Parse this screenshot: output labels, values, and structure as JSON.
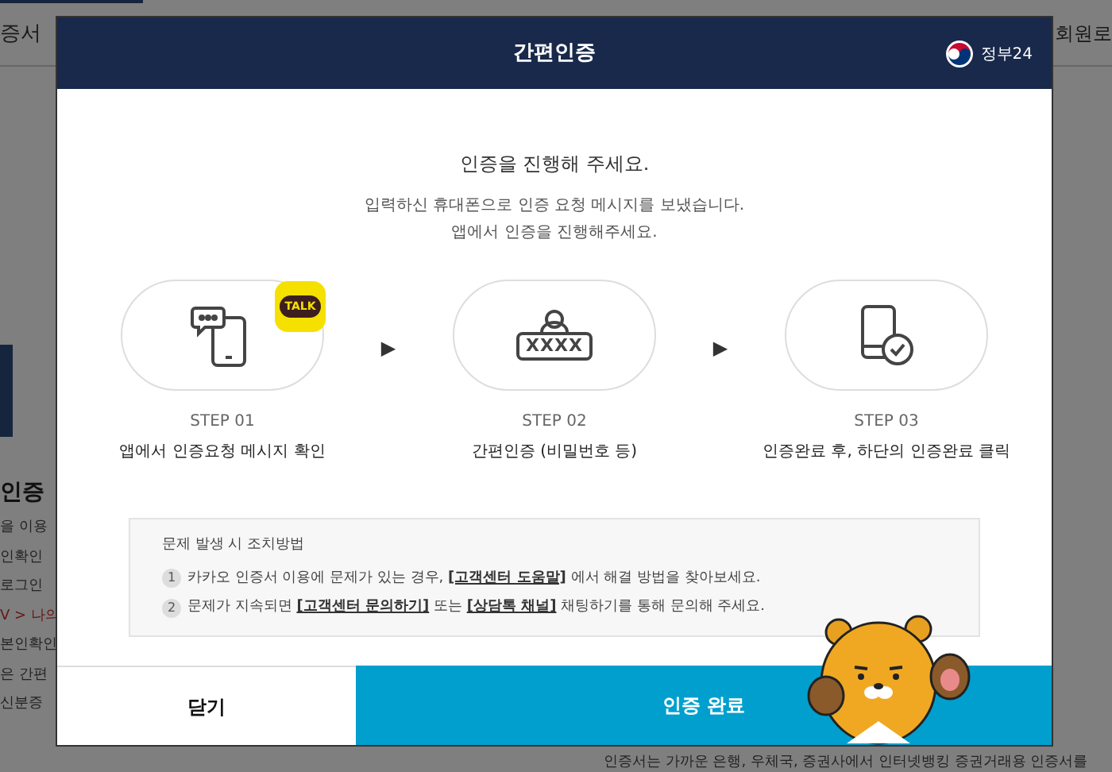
{
  "background": {
    "tabs": [
      "증서",
      "회원로"
    ],
    "heading": "인증",
    "lines": [
      "을 이용",
      "인확인 ",
      "로그인",
      "V > 나의",
      "본인확인",
      "은 간편",
      "신분증"
    ],
    "footer_note": "인증서는 가까운 은행, 우체국, 증권사에서 인터넷뱅킹 증권거래용 인증서를"
  },
  "dialog": {
    "title": "간편인증",
    "brand": "정부24",
    "heading": "인증을 진행해 주세요.",
    "message": [
      "입력하신 휴대폰으로 인증 요청 메시지를 보냈습니다.",
      "앱에서 인증을 진행해주세요."
    ],
    "steps": [
      {
        "kind": "message",
        "badge": "TALK",
        "step": "STEP 01",
        "label": "앱에서 인증요청 메시지 확인"
      },
      {
        "kind": "password",
        "password": "XXXX",
        "step": "STEP 02",
        "label": "간편인증 (비밀번호 등)"
      },
      {
        "kind": "complete",
        "step": "STEP 03",
        "label": "인증완료 후, 하단의 인증완료 클릭"
      }
    ],
    "arrow": "▶",
    "help": {
      "title": "문제 발생 시 조치방법",
      "items": [
        {
          "number": "1",
          "parts": [
            {
              "kind": "text",
              "text": "카카오 인증서 이용에 문제가 있는 경우, "
            },
            {
              "kind": "link",
              "text": "[고객센터 도움말]"
            },
            {
              "kind": "text",
              "text": " 에서 해결 방법을 찾아보세요."
            }
          ]
        },
        {
          "number": "2",
          "parts": [
            {
              "kind": "text",
              "text": "문제가 지속되면 "
            },
            {
              "kind": "link",
              "text": "[고객센터 문의하기]"
            },
            {
              "kind": "text",
              "text": " 또는 "
            },
            {
              "kind": "link",
              "text": "[상담톡 채널]"
            },
            {
              "kind": "text",
              "text": " 채팅하기를 통해 문의해 주세요."
            }
          ]
        }
      ]
    },
    "buttons": [
      {
        "kind": "close",
        "label": "닫기"
      },
      {
        "kind": "confirm",
        "label": "인증 완료"
      }
    ]
  }
}
